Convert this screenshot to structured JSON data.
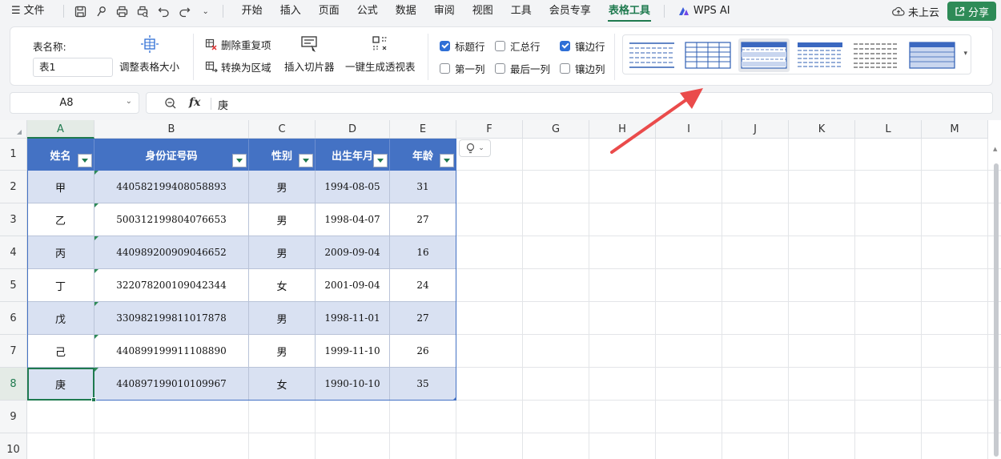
{
  "menubar": {
    "menu_icon": "hamburger-icon",
    "file_label": "文件",
    "tabs": [
      "开始",
      "插入",
      "页面",
      "公式",
      "数据",
      "审阅",
      "视图",
      "工具",
      "会员专享",
      "表格工具"
    ],
    "active_tab": "表格工具",
    "wps_ai_label": "WPS AI",
    "cloud_label": "未上云",
    "share_label": "分享"
  },
  "ribbon": {
    "table_name_label": "表名称:",
    "table_name_value": "表1",
    "resize_label": "调整表格大小",
    "remove_dup_label": "删除重复项",
    "convert_label": "转换为区域",
    "slicer_label": "插入切片器",
    "pivot_label": "一键生成透视表",
    "options": [
      {
        "label": "标题行",
        "checked": true
      },
      {
        "label": "汇总行",
        "checked": false
      },
      {
        "label": "镶边行",
        "checked": true
      },
      {
        "label": "第一列",
        "checked": false
      },
      {
        "label": "最后一列",
        "checked": false
      },
      {
        "label": "镶边列",
        "checked": false
      }
    ]
  },
  "formula_bar": {
    "name_box": "A8",
    "fx": "fx",
    "value": "庚"
  },
  "sheet": {
    "columns": [
      "A",
      "B",
      "C",
      "D",
      "E",
      "F",
      "G",
      "H",
      "I",
      "J",
      "K",
      "L",
      "M"
    ],
    "rows": [
      "1",
      "2",
      "3",
      "4",
      "5",
      "6",
      "7",
      "8",
      "9",
      "10"
    ],
    "selected_cell": "A8",
    "table_headers": [
      "姓名",
      "身份证号码",
      "性别",
      "出生年月",
      "年龄"
    ],
    "table_rows": [
      [
        "甲",
        "440582199408058893",
        "男",
        "1994-08-05",
        "31"
      ],
      [
        "乙",
        "500312199804076653",
        "男",
        "1998-04-07",
        "27"
      ],
      [
        "丙",
        "440989200909046652",
        "男",
        "2009-09-04",
        "16"
      ],
      [
        "丁",
        "322078200109042344",
        "女",
        "2001-09-04",
        "24"
      ],
      [
        "戊",
        "330982199811017878",
        "男",
        "1998-11-01",
        "27"
      ],
      [
        "己",
        "440899199911108890",
        "男",
        "1999-11-10",
        "26"
      ],
      [
        "庚",
        "440897199010109967",
        "女",
        "1990-10-10",
        "35"
      ]
    ]
  },
  "colors": {
    "header_fill": "#4472c4",
    "band_fill": "#d9e1f2",
    "accent_green": "#1f7a4f",
    "annotation_arrow": "#ea4b4b"
  }
}
